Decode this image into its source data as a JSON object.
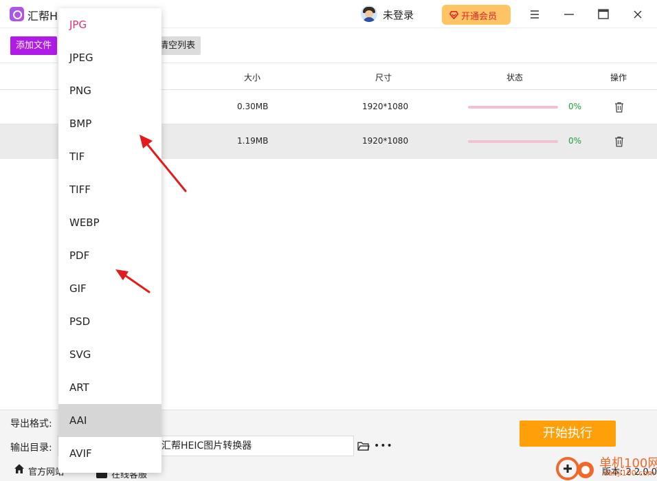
{
  "app": {
    "title": "汇帮HEIC图片转换器"
  },
  "header": {
    "login_label": "未登录",
    "vip_label": "开通会员",
    "icons": [
      "avatar",
      "diamond-icon",
      "menu-icon",
      "minimize-icon",
      "maximize-icon",
      "close-icon"
    ]
  },
  "toolbar": {
    "add_file_label": "添加文件",
    "clear_list_label": "清空列表"
  },
  "table": {
    "columns": [
      "大小",
      "尺寸",
      "状态",
      "操作"
    ],
    "rows": [
      {
        "size": "0.30MB",
        "dimensions": "1920*1080",
        "progress_percent": 0,
        "progress_text": "0%"
      },
      {
        "size": "1.19MB",
        "dimensions": "1920*1080",
        "progress_percent": 0,
        "progress_text": "0%"
      }
    ]
  },
  "format_dropdown": {
    "options": [
      "JPG",
      "JPEG",
      "PNG",
      "BMP",
      "TIF",
      "TIFF",
      "WEBP",
      "PDF",
      "GIF",
      "PSD",
      "SVG",
      "ART",
      "AAI",
      "AVIF"
    ],
    "selected": "JPG",
    "hovered": "AAI",
    "selected_color": "#e0307a"
  },
  "bottom": {
    "export_format_label": "导出格式:",
    "output_dir_label": "输出目录:",
    "output_dir_value": "汇帮HEIC图片转换器",
    "start_button_label": "开始执行",
    "official_site_label": "官方网站",
    "online_service_label": "在线客服",
    "version_label": "版本: 2.2.0.0"
  },
  "watermark": {
    "text": "单机100网",
    "sub": "danji100.com"
  },
  "colors": {
    "accent_purple": "#b11be8",
    "start_orange": "#ff9f0a",
    "vip_yellow": "#ffc564",
    "progress_green": "#1d9d3a",
    "annotation_red": "#e31b1b"
  }
}
